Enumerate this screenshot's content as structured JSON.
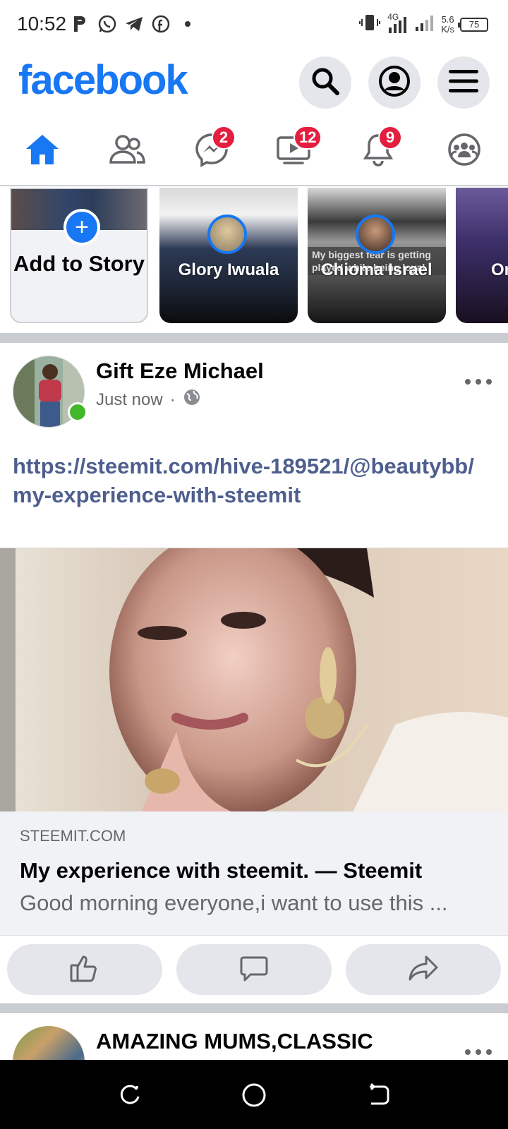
{
  "status_bar": {
    "time": "10:52",
    "net_speed_value": "5.6",
    "net_speed_unit": "K/s",
    "network_type": "4G",
    "battery": "75"
  },
  "header": {
    "logo": "facebook",
    "brand_color": "#1877f2"
  },
  "nav": {
    "tabs": [
      {
        "name": "home",
        "icon": "home-icon",
        "active": true
      },
      {
        "name": "friends",
        "icon": "friends-icon"
      },
      {
        "name": "messenger",
        "icon": "messenger-icon",
        "badge": "2"
      },
      {
        "name": "watch",
        "icon": "watch-icon",
        "badge": "12"
      },
      {
        "name": "notifications",
        "icon": "bell-icon",
        "badge": "9"
      },
      {
        "name": "groups",
        "icon": "groups-icon"
      }
    ]
  },
  "stories": {
    "add_label": "Add to Story",
    "items": [
      {
        "name": "Glory Iwuala"
      },
      {
        "name": "Chioma Israel",
        "caption": "My biggest fear is getting played while being loyal"
      },
      {
        "name": "Or Il"
      }
    ]
  },
  "post": {
    "author": "Gift Eze Michael",
    "time": "Just now",
    "privacy": "globe-icon",
    "link_text": "https://steemit.com/hive-189521/@beautybb/my-experience-with-steemit",
    "preview": {
      "domain": "STEEMIT.COM",
      "title": "My experience with steemit. — Steemit",
      "description": "Good morning everyone,i want to use this ..."
    },
    "actions": [
      "like",
      "comment",
      "share"
    ]
  },
  "post2": {
    "author": "AMAZING MUMS,CLASSIC"
  }
}
